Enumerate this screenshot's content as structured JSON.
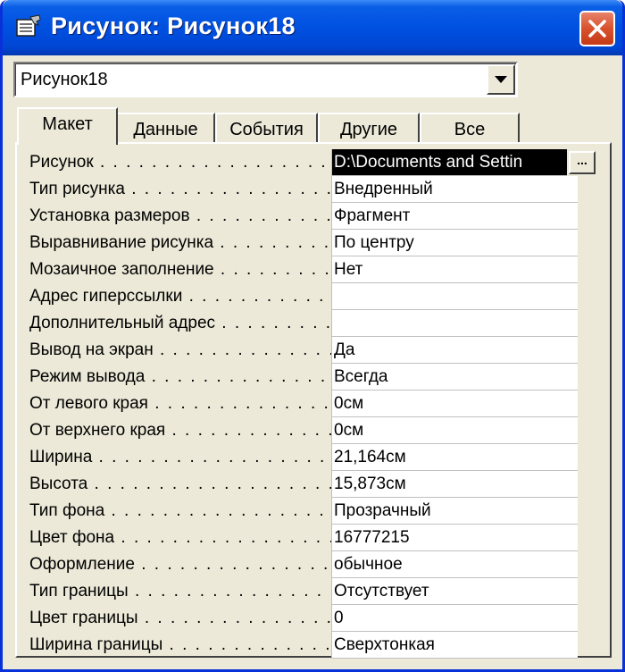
{
  "window": {
    "title": "Рисунок: Рисунок18"
  },
  "selector": {
    "value": "Рисунок18"
  },
  "tabs": [
    {
      "label": "Макет",
      "active": true
    },
    {
      "label": "Данные",
      "active": false
    },
    {
      "label": "События",
      "active": false
    },
    {
      "label": "Другие",
      "active": false
    },
    {
      "label": "Все",
      "active": false
    }
  ],
  "properties": [
    {
      "label": "Рисунок",
      "value": "D:\\Documents and Settin"
    },
    {
      "label": "Тип рисунка",
      "value": "Внедренный"
    },
    {
      "label": "Установка размеров",
      "value": "Фрагмент"
    },
    {
      "label": "Выравнивание рисунка",
      "value": "По центру"
    },
    {
      "label": "Мозаичное заполнение",
      "value": "Нет"
    },
    {
      "label": "Адрес гиперссылки",
      "value": ""
    },
    {
      "label": "Дополнительный адрес",
      "value": ""
    },
    {
      "label": "Вывод на экран",
      "value": "Да"
    },
    {
      "label": "Режим вывода",
      "value": "Всегда"
    },
    {
      "label": "От левого края",
      "value": "0см"
    },
    {
      "label": "От верхнего края",
      "value": "0см"
    },
    {
      "label": "Ширина",
      "value": "21,164см"
    },
    {
      "label": "Высота",
      "value": "15,873см"
    },
    {
      "label": "Тип фона",
      "value": "Прозрачный"
    },
    {
      "label": "Цвет фона",
      "value": "16777215"
    },
    {
      "label": "Оформление",
      "value": "обычное"
    },
    {
      "label": "Тип границы",
      "value": "Отсутствует"
    },
    {
      "label": "Цвет границы",
      "value": "0"
    },
    {
      "label": "Ширина границы",
      "value": "Сверхтонкая"
    }
  ],
  "build_button": {
    "label": "..."
  },
  "colors": {
    "titlebar": "#0050e0",
    "window_face": "#ece9d8",
    "close_button": "#d9512d",
    "selection": "#000000"
  },
  "icons": {
    "title": "properties-sheet-icon",
    "close": "close-icon",
    "dropdown": "chevron-down-icon"
  }
}
